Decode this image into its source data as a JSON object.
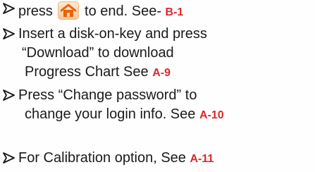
{
  "items": [
    {
      "lines": [
        {
          "before": "press ",
          "after": " to end. See- ",
          "ref": "B-1"
        }
      ]
    },
    {
      "lines": [
        {
          "text": "Insert a disk-on-key and press"
        },
        {
          "text": "“Download” to download"
        },
        {
          "text": "Progress Chart See  ",
          "ref": "A-9"
        }
      ]
    },
    {
      "lines": [
        {
          "text": "Press “Change password” to"
        },
        {
          "text": "change your login info. See ",
          "ref": "A-10"
        }
      ]
    },
    {
      "lines": [
        {
          "text": "For Calibration option, See ",
          "ref": "A-11"
        }
      ]
    }
  ],
  "icons": {
    "bullet": "arrow-bullet-icon",
    "home": "home-icon"
  },
  "colors": {
    "reference": "#e0262b",
    "home_icon": "#e8630a",
    "home_bg": "#f6c79a"
  }
}
